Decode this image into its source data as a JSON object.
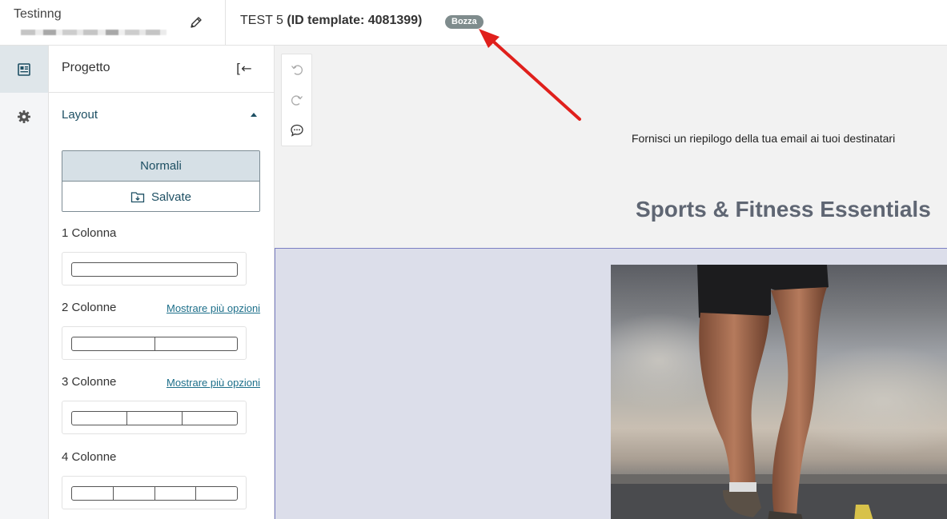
{
  "header": {
    "brand_name": "Testinng",
    "doc_name": "TEST 5",
    "template_id_text": "(ID template: 4081399)",
    "status_badge": "Bozza",
    "edit_icon": "pencil-icon"
  },
  "rail": {
    "items": [
      {
        "icon": "layout-icon",
        "active": true
      },
      {
        "icon": "gear-icon",
        "active": false
      }
    ]
  },
  "panel": {
    "title": "Progetto",
    "collapse_icon": "collapse-left-icon",
    "section_title": "Layout",
    "toggle": {
      "normal_label": "Normali",
      "saved_label": "Salvate",
      "saved_icon": "folder-download-icon"
    },
    "columns": [
      {
        "label": "1 Colonna",
        "count": 1,
        "more_link": ""
      },
      {
        "label": "2 Colonne",
        "count": 2,
        "more_link": "Mostrare più opzioni"
      },
      {
        "label": "3 Colonne",
        "count": 3,
        "more_link": "Mostrare più opzioni"
      },
      {
        "label": "4 Colonne",
        "count": 4,
        "more_link": ""
      }
    ]
  },
  "canvas": {
    "tools": [
      "undo-icon",
      "redo-icon",
      "comment-icon"
    ],
    "preheader": "Fornisci un riepilogo della tua email ai tuoi destinatari",
    "email_title": "Sports & Fitness Essentials",
    "hero_image": "runner-legs-image"
  },
  "colors": {
    "accent": "#1d4f63",
    "badge": "#7f8c8d",
    "selection_border": "#7b7fc4",
    "annotation_arrow": "#e0201c"
  }
}
